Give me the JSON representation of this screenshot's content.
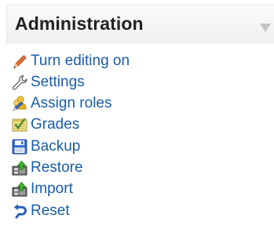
{
  "block": {
    "title": "Administration",
    "collapse_icon": "triangle-down-icon"
  },
  "menu": {
    "items": [
      {
        "label": "Turn editing on",
        "icon": "pencil-icon"
      },
      {
        "label": "Settings",
        "icon": "wrench-icon"
      },
      {
        "label": "Assign roles",
        "icon": "users-icon"
      },
      {
        "label": "Grades",
        "icon": "grades-icon"
      },
      {
        "label": "Backup",
        "icon": "floppy-disk-icon"
      },
      {
        "label": "Restore",
        "icon": "restore-icon"
      },
      {
        "label": "Import",
        "icon": "import-icon"
      },
      {
        "label": "Reset",
        "icon": "reset-icon"
      }
    ]
  },
  "colors": {
    "link": "#1a5da8",
    "title": "#222222",
    "header_bg": "#f4f4f4"
  }
}
